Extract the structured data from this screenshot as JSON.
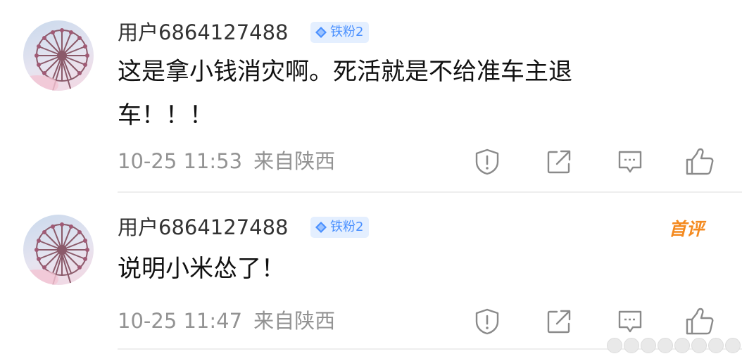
{
  "comments": [
    {
      "username": "用户6864127488",
      "badge": "铁粉2",
      "text": "这是拿小钱消灾啊。死活就是不给准车主退车！！！",
      "time": "10-25 11:53",
      "location": "来自陕西",
      "first_tag": ""
    },
    {
      "username": "用户6864127488",
      "badge": "铁粉2",
      "text": "说明小米怂了！",
      "time": "10-25 11:47",
      "location": "来自陕西",
      "first_tag": "首评"
    }
  ],
  "icons": {
    "report": "shield-exclamation-icon",
    "share": "share-out-icon",
    "reply": "comment-icon",
    "like": "thumbs-up-icon",
    "badge": "diamond-icon"
  },
  "colors": {
    "username": "#333333",
    "text": "#111111",
    "meta": "#939393",
    "badge_bg": "#e4efff",
    "badge_text": "#4a90ff",
    "first_tag": "#f48a1f",
    "divider": "#eeeeee",
    "icon": "#8a8a8a"
  }
}
